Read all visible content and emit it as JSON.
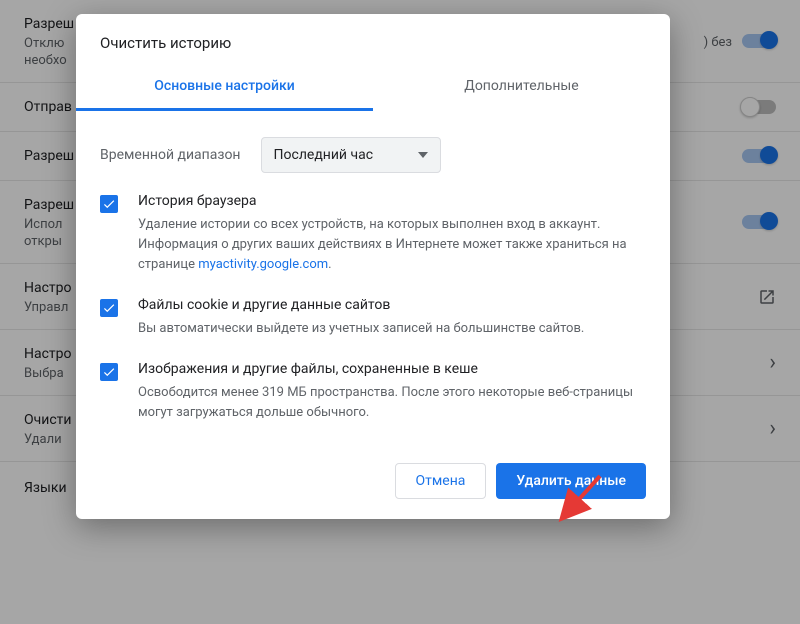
{
  "background": {
    "rows": [
      {
        "title": "Разреш",
        "sub1": "Отклю",
        "sub2": "необхо",
        "right": "toggle-on",
        "tail": ") без"
      },
      {
        "title": "Отправ",
        "sub1": "",
        "sub2": "",
        "right": "toggle-off",
        "tail": ""
      },
      {
        "title": "Разреш",
        "sub1": "",
        "sub2": "",
        "right": "toggle-on",
        "tail": ""
      },
      {
        "title": "Разреш",
        "sub1": "Испол",
        "sub2": "откры",
        "right": "toggle-on",
        "tail": ""
      },
      {
        "title": "Настро",
        "sub1": "Управл",
        "sub2": "",
        "right": "ext-icon",
        "tail": ""
      },
      {
        "title": "Настро",
        "sub1": "Выбра",
        "sub2": "",
        "right": "chev",
        "tail": ""
      },
      {
        "title": "Очисти",
        "sub1": "Удали",
        "sub2": "",
        "right": "chev",
        "tail": ""
      }
    ],
    "section": "Языки"
  },
  "dialog": {
    "title": "Очистить историю",
    "tabs": {
      "basic": "Основные настройки",
      "advanced": "Дополнительные"
    },
    "range": {
      "label": "Временной диапазон",
      "value": "Последний час"
    },
    "items": [
      {
        "title": "История браузера",
        "desc_pre": "Удаление истории со всех устройств, на которых выполнен вход в аккаунт. Информация о других ваших действиях в Интернете может также храниться на странице ",
        "link": "myactivity.google.com",
        "desc_post": "."
      },
      {
        "title": "Файлы cookie и другие данные сайтов",
        "desc_pre": "Вы автоматически выйдете из учетных записей на большинстве сайтов.",
        "link": "",
        "desc_post": ""
      },
      {
        "title": "Изображения и другие файлы, сохраненные в кеше",
        "desc_pre": "Освободится менее 319 МБ пространства. После этого некоторые веб-страницы могут загружаться дольше обычного.",
        "link": "",
        "desc_post": ""
      }
    ],
    "actions": {
      "cancel": "Отмена",
      "confirm": "Удалить данные"
    }
  }
}
